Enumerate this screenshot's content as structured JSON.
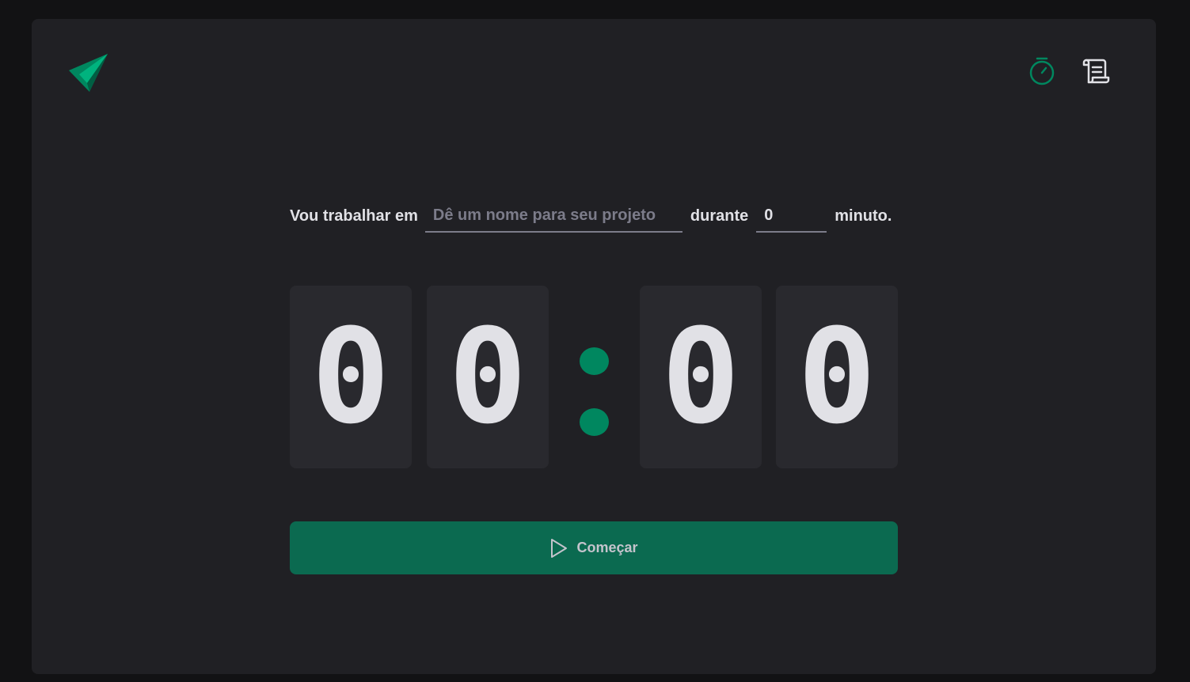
{
  "header": {
    "logo_icon": "paper-plane-icon",
    "nav": [
      {
        "icon": "timer-icon",
        "color": "#00875f",
        "active": true
      },
      {
        "icon": "scroll-icon",
        "color": "#e1e1e6",
        "active": false
      }
    ]
  },
  "form": {
    "task_label": "Vou trabalhar em",
    "task_placeholder": "Dê um nome para seu projeto",
    "task_value": "",
    "duration_label": "durante",
    "minutes_value": "0",
    "minutes_suffix": "minuto."
  },
  "countdown": {
    "minutes_tens": "0",
    "minutes_ones": "0",
    "separator": ":",
    "seconds_tens": "0",
    "seconds_ones": "0"
  },
  "start_button": {
    "label": "Começar",
    "icon": "play-icon"
  },
  "colors": {
    "accent": "#00875f",
    "button_bg": "#0b6a50",
    "panel_bg": "#202024",
    "page_bg": "#121214",
    "digit_bg": "#29292e",
    "text": "#e1e1e6"
  }
}
